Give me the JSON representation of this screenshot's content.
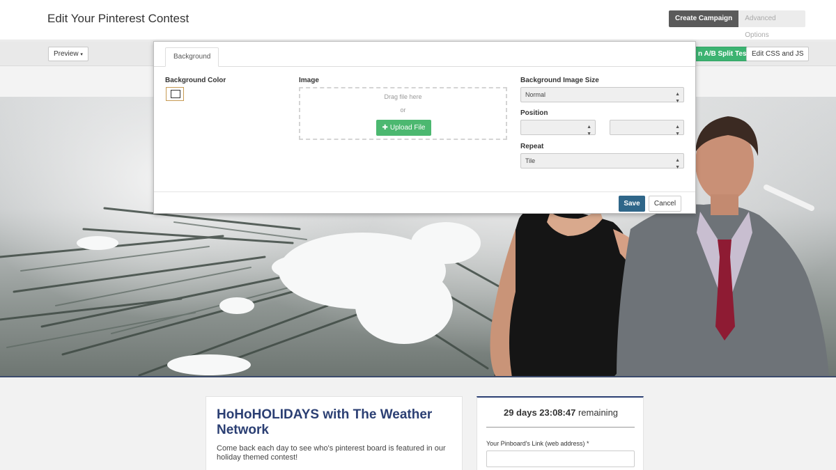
{
  "header": {
    "title": "Edit Your Pinterest Contest",
    "steps": [
      "Create Campaign",
      "Advanced Options"
    ]
  },
  "toolbar": {
    "preview_label": "Preview",
    "ab_label": "n A/B Split Test",
    "css_label": "Edit CSS and JS"
  },
  "modal": {
    "tab": "Background",
    "bg_color_label": "Background Color",
    "image_label": "Image",
    "drag_text": "Drag file here",
    "or_text": "or",
    "upload_label": "Upload File",
    "size_label": "Background Image Size",
    "size_value": "Normal",
    "position_label": "Position",
    "position_value_1": "",
    "position_value_2": "",
    "repeat_label": "Repeat",
    "repeat_value": "Tile",
    "save_label": "Save",
    "cancel_label": "Cancel"
  },
  "contest": {
    "title": "HoHoHOLIDAYS with The Weather Network",
    "description": "Come back each day to see who's pinterest board is featured in our holiday themed contest!"
  },
  "timer": {
    "countdown": "29 days 23:08:47",
    "suffix": " remaining",
    "field_label": "Your Pinboard's Link (web address) *",
    "field_value": ""
  },
  "colors": {
    "accent_green": "#3cb371",
    "save_blue": "#2f6689",
    "title_navy": "#2b3f73"
  }
}
